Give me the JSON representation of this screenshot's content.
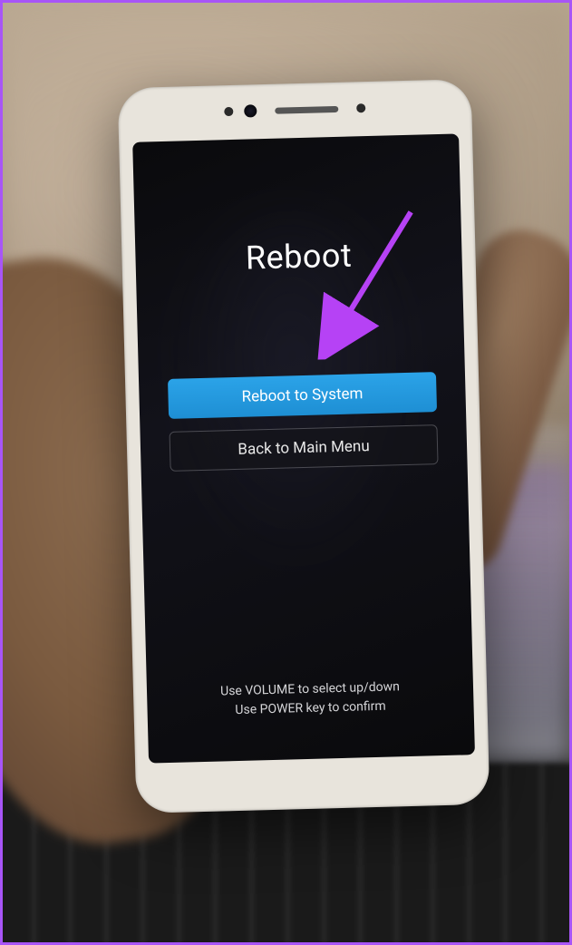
{
  "screen": {
    "title": "Reboot",
    "menu": [
      {
        "label": "Reboot to System",
        "selected": true
      },
      {
        "label": "Back to Main Menu",
        "selected": false
      }
    ],
    "instructions": {
      "line1": "Use VOLUME to select up/down",
      "line2": "Use POWER key to confirm"
    }
  },
  "annotation": {
    "arrow_color": "#b642f5"
  }
}
